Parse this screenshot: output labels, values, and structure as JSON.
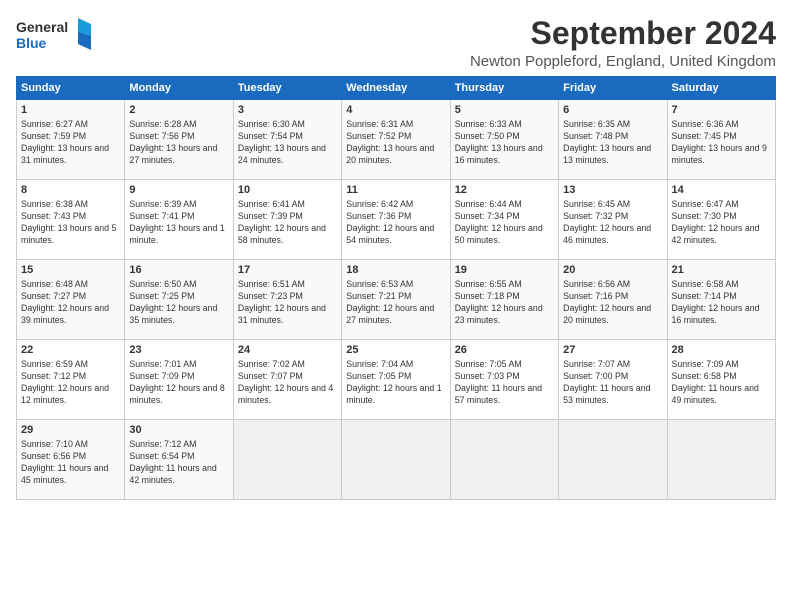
{
  "header": {
    "logo_line1": "General",
    "logo_line2": "Blue",
    "title": "September 2024",
    "subtitle": "Newton Poppleford, England, United Kingdom"
  },
  "weekdays": [
    "Sunday",
    "Monday",
    "Tuesday",
    "Wednesday",
    "Thursday",
    "Friday",
    "Saturday"
  ],
  "weeks": [
    [
      {
        "day": "1",
        "sunrise": "Sunrise: 6:27 AM",
        "sunset": "Sunset: 7:59 PM",
        "daylight": "Daylight: 13 hours and 31 minutes."
      },
      {
        "day": "2",
        "sunrise": "Sunrise: 6:28 AM",
        "sunset": "Sunset: 7:56 PM",
        "daylight": "Daylight: 13 hours and 27 minutes."
      },
      {
        "day": "3",
        "sunrise": "Sunrise: 6:30 AM",
        "sunset": "Sunset: 7:54 PM",
        "daylight": "Daylight: 13 hours and 24 minutes."
      },
      {
        "day": "4",
        "sunrise": "Sunrise: 6:31 AM",
        "sunset": "Sunset: 7:52 PM",
        "daylight": "Daylight: 13 hours and 20 minutes."
      },
      {
        "day": "5",
        "sunrise": "Sunrise: 6:33 AM",
        "sunset": "Sunset: 7:50 PM",
        "daylight": "Daylight: 13 hours and 16 minutes."
      },
      {
        "day": "6",
        "sunrise": "Sunrise: 6:35 AM",
        "sunset": "Sunset: 7:48 PM",
        "daylight": "Daylight: 13 hours and 13 minutes."
      },
      {
        "day": "7",
        "sunrise": "Sunrise: 6:36 AM",
        "sunset": "Sunset: 7:45 PM",
        "daylight": "Daylight: 13 hours and 9 minutes."
      }
    ],
    [
      {
        "day": "8",
        "sunrise": "Sunrise: 6:38 AM",
        "sunset": "Sunset: 7:43 PM",
        "daylight": "Daylight: 13 hours and 5 minutes."
      },
      {
        "day": "9",
        "sunrise": "Sunrise: 6:39 AM",
        "sunset": "Sunset: 7:41 PM",
        "daylight": "Daylight: 13 hours and 1 minute."
      },
      {
        "day": "10",
        "sunrise": "Sunrise: 6:41 AM",
        "sunset": "Sunset: 7:39 PM",
        "daylight": "Daylight: 12 hours and 58 minutes."
      },
      {
        "day": "11",
        "sunrise": "Sunrise: 6:42 AM",
        "sunset": "Sunset: 7:36 PM",
        "daylight": "Daylight: 12 hours and 54 minutes."
      },
      {
        "day": "12",
        "sunrise": "Sunrise: 6:44 AM",
        "sunset": "Sunset: 7:34 PM",
        "daylight": "Daylight: 12 hours and 50 minutes."
      },
      {
        "day": "13",
        "sunrise": "Sunrise: 6:45 AM",
        "sunset": "Sunset: 7:32 PM",
        "daylight": "Daylight: 12 hours and 46 minutes."
      },
      {
        "day": "14",
        "sunrise": "Sunrise: 6:47 AM",
        "sunset": "Sunset: 7:30 PM",
        "daylight": "Daylight: 12 hours and 42 minutes."
      }
    ],
    [
      {
        "day": "15",
        "sunrise": "Sunrise: 6:48 AM",
        "sunset": "Sunset: 7:27 PM",
        "daylight": "Daylight: 12 hours and 39 minutes."
      },
      {
        "day": "16",
        "sunrise": "Sunrise: 6:50 AM",
        "sunset": "Sunset: 7:25 PM",
        "daylight": "Daylight: 12 hours and 35 minutes."
      },
      {
        "day": "17",
        "sunrise": "Sunrise: 6:51 AM",
        "sunset": "Sunset: 7:23 PM",
        "daylight": "Daylight: 12 hours and 31 minutes."
      },
      {
        "day": "18",
        "sunrise": "Sunrise: 6:53 AM",
        "sunset": "Sunset: 7:21 PM",
        "daylight": "Daylight: 12 hours and 27 minutes."
      },
      {
        "day": "19",
        "sunrise": "Sunrise: 6:55 AM",
        "sunset": "Sunset: 7:18 PM",
        "daylight": "Daylight: 12 hours and 23 minutes."
      },
      {
        "day": "20",
        "sunrise": "Sunrise: 6:56 AM",
        "sunset": "Sunset: 7:16 PM",
        "daylight": "Daylight: 12 hours and 20 minutes."
      },
      {
        "day": "21",
        "sunrise": "Sunrise: 6:58 AM",
        "sunset": "Sunset: 7:14 PM",
        "daylight": "Daylight: 12 hours and 16 minutes."
      }
    ],
    [
      {
        "day": "22",
        "sunrise": "Sunrise: 6:59 AM",
        "sunset": "Sunset: 7:12 PM",
        "daylight": "Daylight: 12 hours and 12 minutes."
      },
      {
        "day": "23",
        "sunrise": "Sunrise: 7:01 AM",
        "sunset": "Sunset: 7:09 PM",
        "daylight": "Daylight: 12 hours and 8 minutes."
      },
      {
        "day": "24",
        "sunrise": "Sunrise: 7:02 AM",
        "sunset": "Sunset: 7:07 PM",
        "daylight": "Daylight: 12 hours and 4 minutes."
      },
      {
        "day": "25",
        "sunrise": "Sunrise: 7:04 AM",
        "sunset": "Sunset: 7:05 PM",
        "daylight": "Daylight: 12 hours and 1 minute."
      },
      {
        "day": "26",
        "sunrise": "Sunrise: 7:05 AM",
        "sunset": "Sunset: 7:03 PM",
        "daylight": "Daylight: 11 hours and 57 minutes."
      },
      {
        "day": "27",
        "sunrise": "Sunrise: 7:07 AM",
        "sunset": "Sunset: 7:00 PM",
        "daylight": "Daylight: 11 hours and 53 minutes."
      },
      {
        "day": "28",
        "sunrise": "Sunrise: 7:09 AM",
        "sunset": "Sunset: 6:58 PM",
        "daylight": "Daylight: 11 hours and 49 minutes."
      }
    ],
    [
      {
        "day": "29",
        "sunrise": "Sunrise: 7:10 AM",
        "sunset": "Sunset: 6:56 PM",
        "daylight": "Daylight: 11 hours and 45 minutes."
      },
      {
        "day": "30",
        "sunrise": "Sunrise: 7:12 AM",
        "sunset": "Sunset: 6:54 PM",
        "daylight": "Daylight: 11 hours and 42 minutes."
      },
      {
        "day": "",
        "sunrise": "",
        "sunset": "",
        "daylight": ""
      },
      {
        "day": "",
        "sunrise": "",
        "sunset": "",
        "daylight": ""
      },
      {
        "day": "",
        "sunrise": "",
        "sunset": "",
        "daylight": ""
      },
      {
        "day": "",
        "sunrise": "",
        "sunset": "",
        "daylight": ""
      },
      {
        "day": "",
        "sunrise": "",
        "sunset": "",
        "daylight": ""
      }
    ]
  ]
}
